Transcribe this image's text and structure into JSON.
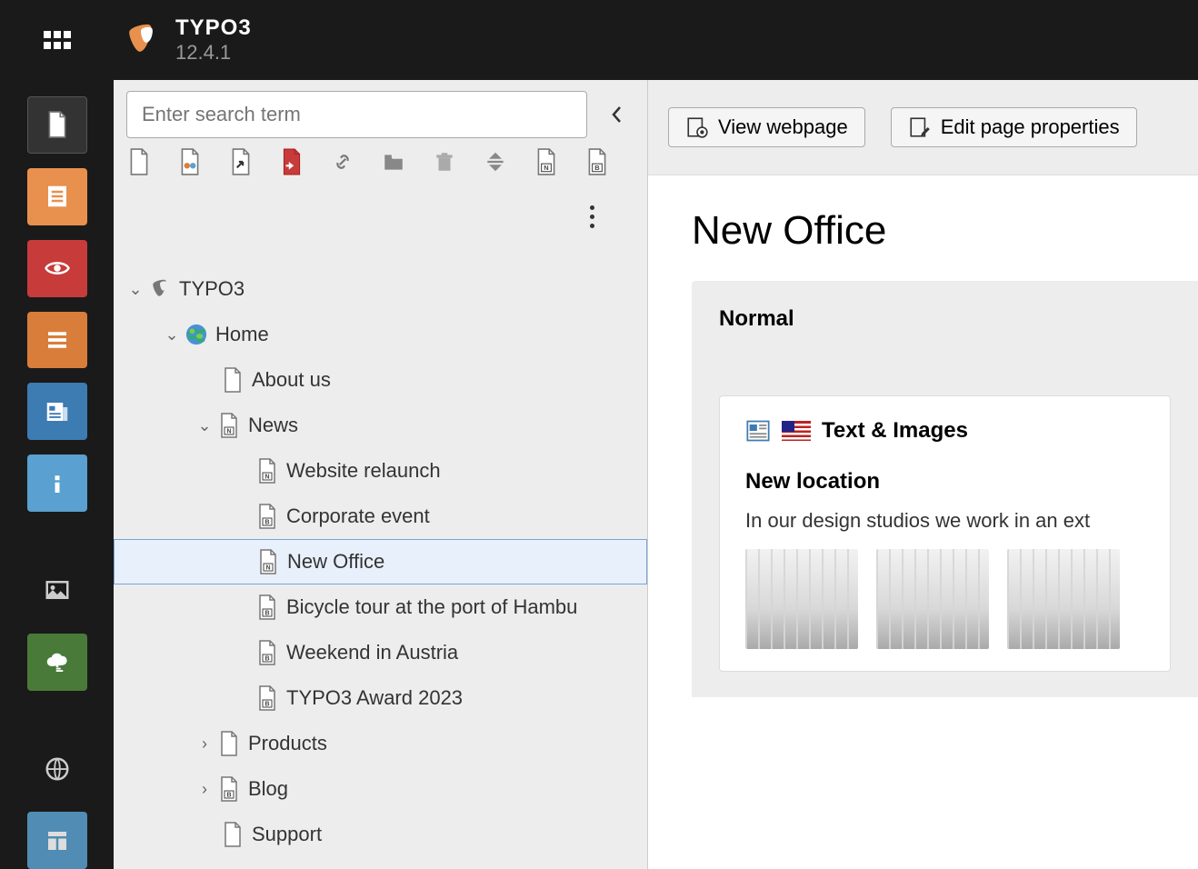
{
  "app": {
    "name": "TYPO3",
    "version": "12.4.1"
  },
  "search": {
    "placeholder": "Enter search term"
  },
  "tree": {
    "root": "TYPO3",
    "home": "Home",
    "about": "About us",
    "news": "News",
    "news_children": [
      "Website relaunch",
      "Corporate event",
      "New Office",
      "Bicycle tour at the port of Hambu",
      "Weekend in Austria",
      "TYPO3 Award 2023"
    ],
    "products": "Products",
    "blog": "Blog",
    "support": "Support"
  },
  "actions": {
    "view": "View webpage",
    "edit": "Edit page properties"
  },
  "page": {
    "title": "New Office",
    "colpos_label": "Normal",
    "ce": {
      "type": "Text & Images",
      "heading": "New location",
      "text": "In our design studios we work in an ext"
    }
  }
}
